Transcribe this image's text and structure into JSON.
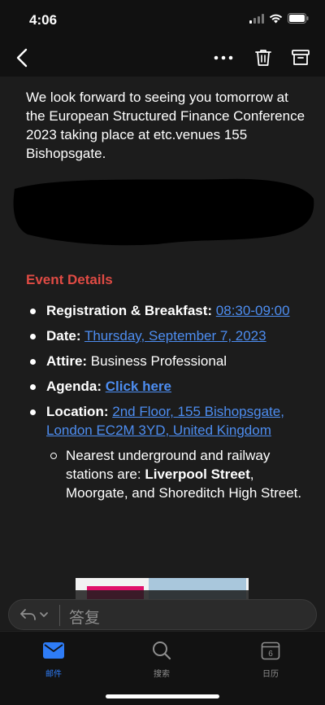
{
  "status": {
    "time": "4:06"
  },
  "email": {
    "intro": "We look forward to seeing you tomorrow at the European Structured Finance Conference 2023 taking place at etc.venues 155 Bishopsgate.",
    "section_heading": "Event Details",
    "details": [
      {
        "label": "Registration & Breakfast:",
        "value": "08:30-09:00",
        "link": true
      },
      {
        "label": "Date:",
        "value": "Thursday, September 7, 2023",
        "link": true
      },
      {
        "label": "Attire:",
        "value": "Business Professional",
        "link": false
      },
      {
        "label": "Agenda:",
        "value": "Click here",
        "link": true
      },
      {
        "label": "Location:",
        "value": "2nd Floor, 155 Bishopsgate, London EC2M 3YD, United Kingdom",
        "link": true
      }
    ],
    "subnote": {
      "prefix": "Nearest underground and railway stations are:",
      "bold": "Liverpool Street",
      "suffix": ", Moorgate, and Shoreditch High Street."
    }
  },
  "reply": {
    "label": "答复"
  },
  "tabs": [
    {
      "label": "邮件",
      "icon": "mail-icon",
      "active": true
    },
    {
      "label": "搜索",
      "icon": "search-icon",
      "active": false
    },
    {
      "label": "日历",
      "icon": "calendar-icon",
      "active": false,
      "day": "6"
    }
  ],
  "colors": {
    "link": "#4d8df0",
    "heading": "#e04b44",
    "active_tab": "#2e7cf6"
  }
}
